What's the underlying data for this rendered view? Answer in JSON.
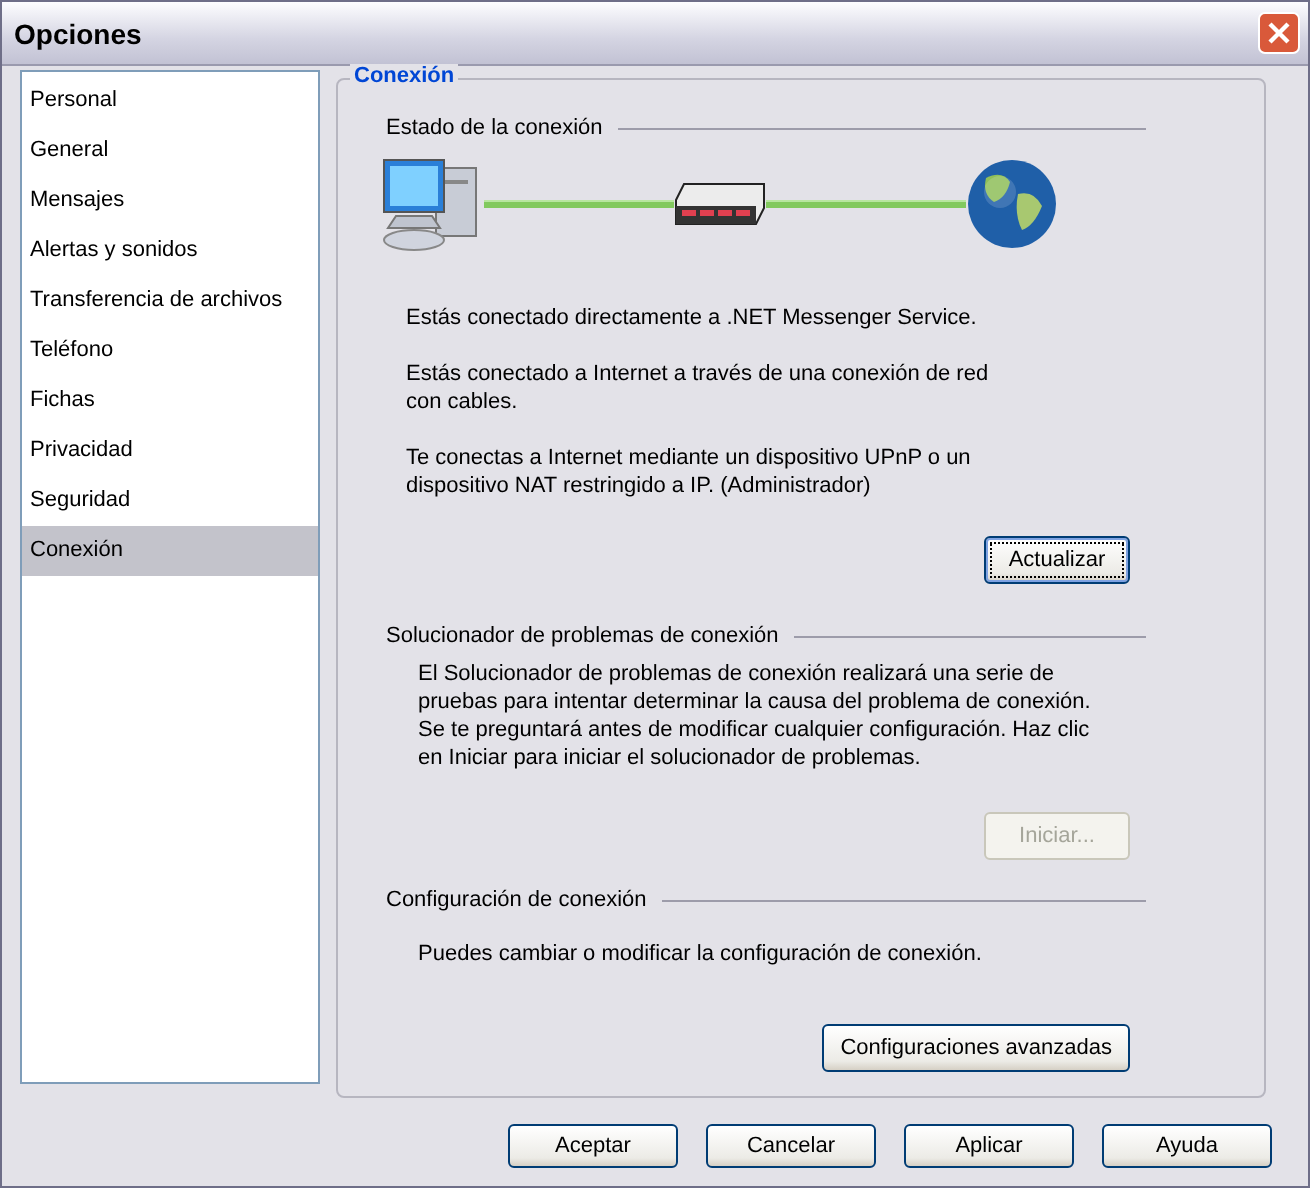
{
  "window": {
    "title": "Opciones"
  },
  "sidebar": {
    "items": [
      {
        "label": "Personal",
        "selected": false
      },
      {
        "label": "General",
        "selected": false
      },
      {
        "label": "Mensajes",
        "selected": false
      },
      {
        "label": "Alertas y sonidos",
        "selected": false
      },
      {
        "label": "Transferencia de archivos",
        "selected": false
      },
      {
        "label": "Teléfono",
        "selected": false
      },
      {
        "label": "Fichas",
        "selected": false
      },
      {
        "label": "Privacidad",
        "selected": false
      },
      {
        "label": "Seguridad",
        "selected": false
      },
      {
        "label": "Conexión",
        "selected": true
      }
    ]
  },
  "panel": {
    "title": "Conexión",
    "sections": [
      {
        "kind": "diagram",
        "heading": "Estado de la conexión",
        "paragraphs": [
          "Estás conectado directamente a .NET Messenger Service.",
          "Estás conectado a Internet a través de una conexión de red con cables.",
          "Te conectas a Internet mediante un dispositivo UPnP o un dispositivo NAT restringido a IP.  (Administrador)"
        ],
        "button": {
          "label": "Actualizar",
          "disabled": false,
          "focused": true
        }
      },
      {
        "kind": "text",
        "heading": "Solucionador de problemas de conexión",
        "paragraphs": [
          "El Solucionador de problemas de conexión realizará una serie de pruebas para intentar determinar la causa del problema de conexión. Se te preguntará antes de modificar cualquier configuración. Haz clic en Iniciar para iniciar el solucionador de problemas."
        ],
        "button": {
          "label": "Iniciar...",
          "disabled": true,
          "focused": false
        }
      },
      {
        "kind": "text",
        "heading": "Configuración de conexión",
        "paragraphs": [
          "Puedes cambiar o modificar la configuración de conexión."
        ],
        "button": {
          "label": "Configuraciones avanzadas",
          "disabled": false,
          "focused": false
        }
      }
    ]
  },
  "buttons": [
    "Aceptar",
    "Cancelar",
    "Aplicar",
    "Ayuda"
  ]
}
